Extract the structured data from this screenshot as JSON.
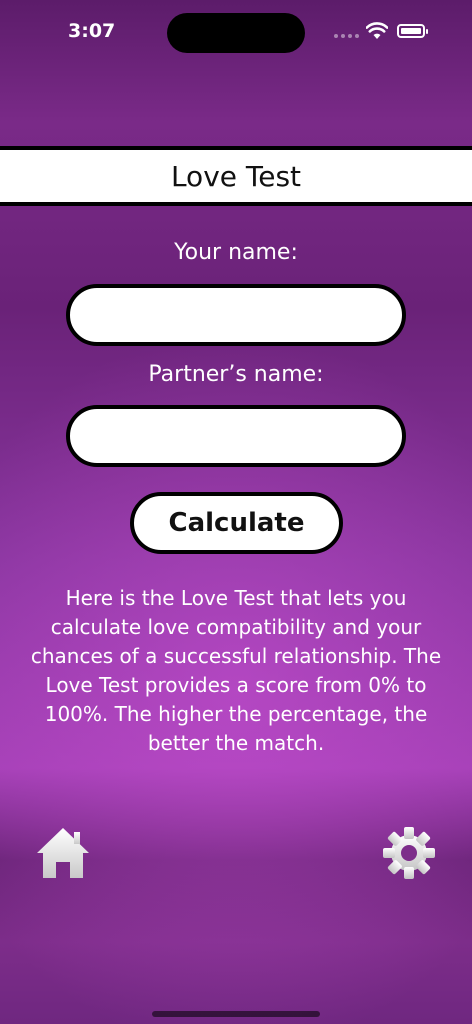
{
  "status_bar": {
    "time": "3:07"
  },
  "header": {
    "title": "Love Test"
  },
  "form": {
    "your_name_label": "Your name:",
    "your_name_value": "",
    "partner_name_label": "Partner’s name:",
    "partner_name_value": "",
    "calculate_label": "Calculate"
  },
  "description": "Here is the Love Test that lets you calculate love compatibility and your chances of a successful relationship. The Love Test provides a score from 0% to 100%. The higher the percentage, the better the match.",
  "tab_bar": {
    "left_icon": "home-icon",
    "right_icon": "gear-icon"
  },
  "colors": {
    "background": "#7a2a88",
    "accent": "#a440b6",
    "field": "#ffffff",
    "border": "#000000"
  }
}
